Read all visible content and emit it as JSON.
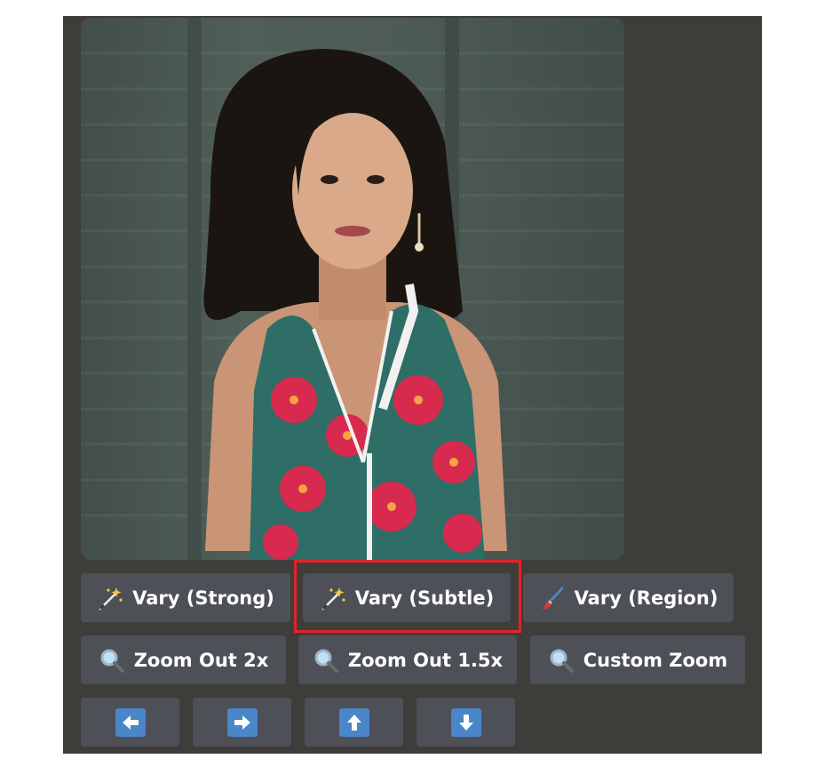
{
  "image": {
    "alt": "portrait"
  },
  "variation_buttons": [
    {
      "label": "Vary (Strong)",
      "icon": "magic-wand-icon"
    },
    {
      "label": "Vary (Subtle)",
      "icon": "magic-wand-icon"
    },
    {
      "label": "Vary (Region)",
      "icon": "paintbrush-icon"
    }
  ],
  "zoom_buttons": [
    {
      "label": "Zoom Out 2x",
      "icon": "magnifier-icon"
    },
    {
      "label": "Zoom Out 1.5x",
      "icon": "magnifier-icon"
    },
    {
      "label": "Custom Zoom",
      "icon": "magnifier-icon"
    }
  ],
  "pan_buttons": [
    {
      "icon": "arrow-left-icon"
    },
    {
      "icon": "arrow-right-icon"
    },
    {
      "icon": "arrow-up-icon"
    },
    {
      "icon": "arrow-down-icon"
    }
  ],
  "highlighted_button": "Vary (Subtle)",
  "colors": {
    "panel_bg": "#3f3d3a",
    "button_bg": "#4e5058",
    "arrow_blue": "#4a86c8",
    "highlight_red": "#e0232b"
  }
}
